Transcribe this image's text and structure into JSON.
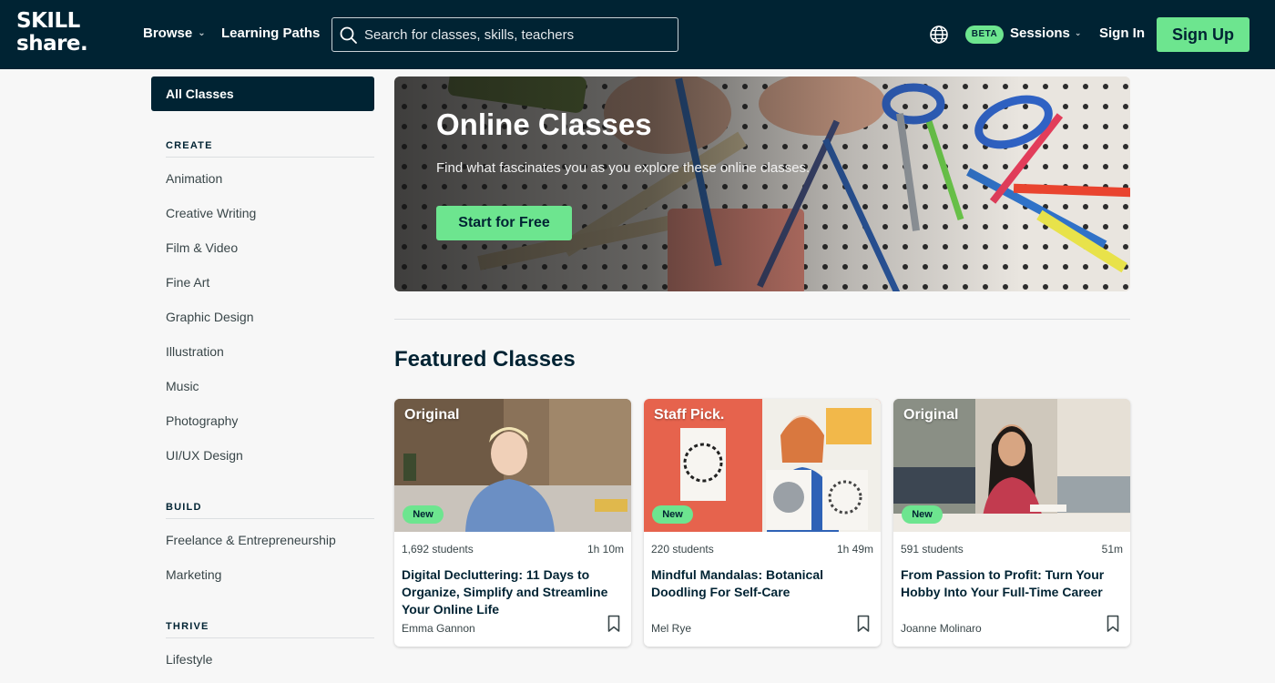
{
  "header": {
    "logo_line1": "SKILL",
    "logo_line2": "share.",
    "browse_label": "Browse",
    "learning_paths_label": "Learning Paths",
    "search_placeholder": "Search for classes, skills, teachers",
    "beta_badge": "BETA",
    "sessions_label": "Sessions",
    "sign_in_label": "Sign In",
    "sign_up_label": "Sign Up"
  },
  "sidebar": {
    "all_classes": "All Classes",
    "sections": [
      {
        "heading": "CREATE",
        "items": [
          "Animation",
          "Creative Writing",
          "Film & Video",
          "Fine Art",
          "Graphic Design",
          "Illustration",
          "Music",
          "Photography",
          "UI/UX Design"
        ]
      },
      {
        "heading": "BUILD",
        "items": [
          "Freelance & Entrepreneurship",
          "Marketing"
        ]
      },
      {
        "heading": "THRIVE",
        "items": [
          "Lifestyle"
        ]
      }
    ]
  },
  "hero": {
    "title": "Online Classes",
    "subtitle": "Find what fascinates you as you explore these online classes.",
    "cta_label": "Start for Free"
  },
  "featured": {
    "title": "Featured Classes",
    "cards": [
      {
        "tag": "Original",
        "badge": "New",
        "students": "1,692 students",
        "duration": "1h 10m",
        "title": "Digital Decluttering: 11 Days to Organize, Simplify and Streamline Your Online Life",
        "teacher": "Emma Gannon"
      },
      {
        "tag": "Staff Pick.",
        "badge": "New",
        "students": "220 students",
        "duration": "1h 49m",
        "title": "Mindful Mandalas: Botanical Doodling For Self-Care",
        "teacher": "Mel Rye"
      },
      {
        "tag": "Original",
        "badge": "New",
        "students": "591 students",
        "duration": "51m",
        "title": "From Passion to Profit: Turn Your Hobby Into Your Full-Time Career",
        "teacher": "Joanne Molinaro"
      }
    ]
  },
  "icons": {
    "search": "search-icon",
    "globe": "globe-icon",
    "chevron": "chevron-down-icon",
    "bookmark": "bookmark-icon"
  },
  "colors": {
    "navy": "#002333",
    "green": "#6de58f",
    "background": "#f7f7f7"
  }
}
